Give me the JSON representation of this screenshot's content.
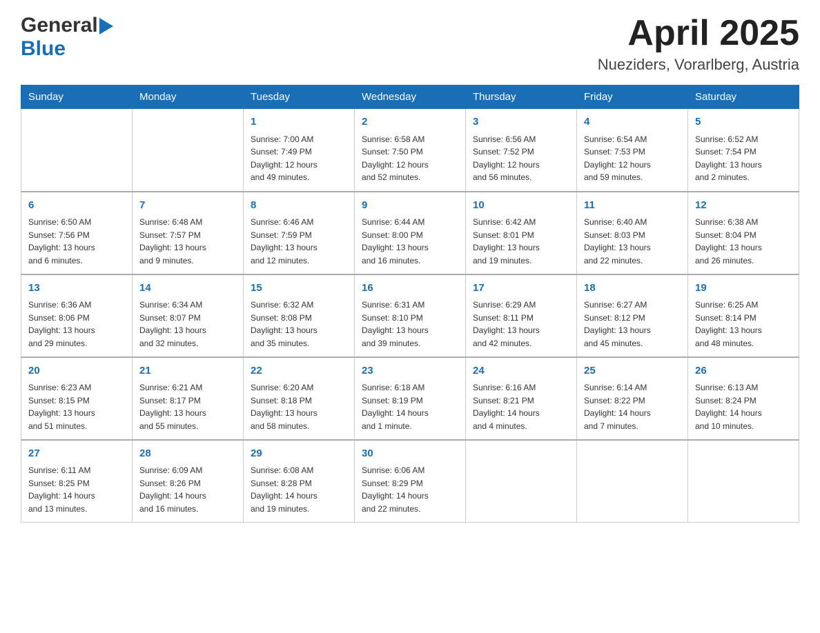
{
  "header": {
    "logo_general": "General",
    "logo_blue": "Blue",
    "month_title": "April 2025",
    "location": "Nueziders, Vorarlberg, Austria"
  },
  "days_of_week": [
    "Sunday",
    "Monday",
    "Tuesday",
    "Wednesday",
    "Thursday",
    "Friday",
    "Saturday"
  ],
  "weeks": [
    [
      {
        "day": "",
        "info": ""
      },
      {
        "day": "",
        "info": ""
      },
      {
        "day": "1",
        "info": "Sunrise: 7:00 AM\nSunset: 7:49 PM\nDaylight: 12 hours\nand 49 minutes."
      },
      {
        "day": "2",
        "info": "Sunrise: 6:58 AM\nSunset: 7:50 PM\nDaylight: 12 hours\nand 52 minutes."
      },
      {
        "day": "3",
        "info": "Sunrise: 6:56 AM\nSunset: 7:52 PM\nDaylight: 12 hours\nand 56 minutes."
      },
      {
        "day": "4",
        "info": "Sunrise: 6:54 AM\nSunset: 7:53 PM\nDaylight: 12 hours\nand 59 minutes."
      },
      {
        "day": "5",
        "info": "Sunrise: 6:52 AM\nSunset: 7:54 PM\nDaylight: 13 hours\nand 2 minutes."
      }
    ],
    [
      {
        "day": "6",
        "info": "Sunrise: 6:50 AM\nSunset: 7:56 PM\nDaylight: 13 hours\nand 6 minutes."
      },
      {
        "day": "7",
        "info": "Sunrise: 6:48 AM\nSunset: 7:57 PM\nDaylight: 13 hours\nand 9 minutes."
      },
      {
        "day": "8",
        "info": "Sunrise: 6:46 AM\nSunset: 7:59 PM\nDaylight: 13 hours\nand 12 minutes."
      },
      {
        "day": "9",
        "info": "Sunrise: 6:44 AM\nSunset: 8:00 PM\nDaylight: 13 hours\nand 16 minutes."
      },
      {
        "day": "10",
        "info": "Sunrise: 6:42 AM\nSunset: 8:01 PM\nDaylight: 13 hours\nand 19 minutes."
      },
      {
        "day": "11",
        "info": "Sunrise: 6:40 AM\nSunset: 8:03 PM\nDaylight: 13 hours\nand 22 minutes."
      },
      {
        "day": "12",
        "info": "Sunrise: 6:38 AM\nSunset: 8:04 PM\nDaylight: 13 hours\nand 26 minutes."
      }
    ],
    [
      {
        "day": "13",
        "info": "Sunrise: 6:36 AM\nSunset: 8:06 PM\nDaylight: 13 hours\nand 29 minutes."
      },
      {
        "day": "14",
        "info": "Sunrise: 6:34 AM\nSunset: 8:07 PM\nDaylight: 13 hours\nand 32 minutes."
      },
      {
        "day": "15",
        "info": "Sunrise: 6:32 AM\nSunset: 8:08 PM\nDaylight: 13 hours\nand 35 minutes."
      },
      {
        "day": "16",
        "info": "Sunrise: 6:31 AM\nSunset: 8:10 PM\nDaylight: 13 hours\nand 39 minutes."
      },
      {
        "day": "17",
        "info": "Sunrise: 6:29 AM\nSunset: 8:11 PM\nDaylight: 13 hours\nand 42 minutes."
      },
      {
        "day": "18",
        "info": "Sunrise: 6:27 AM\nSunset: 8:12 PM\nDaylight: 13 hours\nand 45 minutes."
      },
      {
        "day": "19",
        "info": "Sunrise: 6:25 AM\nSunset: 8:14 PM\nDaylight: 13 hours\nand 48 minutes."
      }
    ],
    [
      {
        "day": "20",
        "info": "Sunrise: 6:23 AM\nSunset: 8:15 PM\nDaylight: 13 hours\nand 51 minutes."
      },
      {
        "day": "21",
        "info": "Sunrise: 6:21 AM\nSunset: 8:17 PM\nDaylight: 13 hours\nand 55 minutes."
      },
      {
        "day": "22",
        "info": "Sunrise: 6:20 AM\nSunset: 8:18 PM\nDaylight: 13 hours\nand 58 minutes."
      },
      {
        "day": "23",
        "info": "Sunrise: 6:18 AM\nSunset: 8:19 PM\nDaylight: 14 hours\nand 1 minute."
      },
      {
        "day": "24",
        "info": "Sunrise: 6:16 AM\nSunset: 8:21 PM\nDaylight: 14 hours\nand 4 minutes."
      },
      {
        "day": "25",
        "info": "Sunrise: 6:14 AM\nSunset: 8:22 PM\nDaylight: 14 hours\nand 7 minutes."
      },
      {
        "day": "26",
        "info": "Sunrise: 6:13 AM\nSunset: 8:24 PM\nDaylight: 14 hours\nand 10 minutes."
      }
    ],
    [
      {
        "day": "27",
        "info": "Sunrise: 6:11 AM\nSunset: 8:25 PM\nDaylight: 14 hours\nand 13 minutes."
      },
      {
        "day": "28",
        "info": "Sunrise: 6:09 AM\nSunset: 8:26 PM\nDaylight: 14 hours\nand 16 minutes."
      },
      {
        "day": "29",
        "info": "Sunrise: 6:08 AM\nSunset: 8:28 PM\nDaylight: 14 hours\nand 19 minutes."
      },
      {
        "day": "30",
        "info": "Sunrise: 6:06 AM\nSunset: 8:29 PM\nDaylight: 14 hours\nand 22 minutes."
      },
      {
        "day": "",
        "info": ""
      },
      {
        "day": "",
        "info": ""
      },
      {
        "day": "",
        "info": ""
      }
    ]
  ]
}
